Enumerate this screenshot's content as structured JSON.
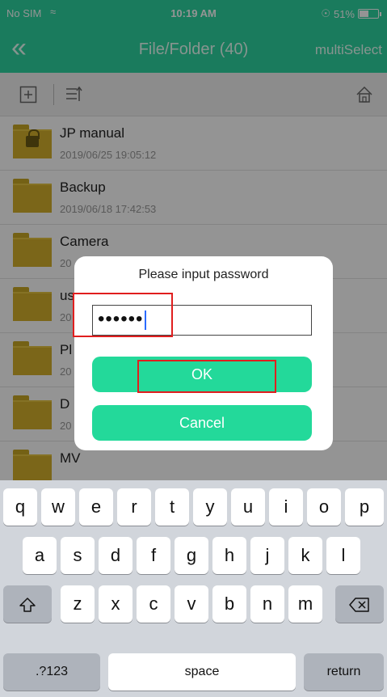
{
  "status": {
    "carrier": "No SIM",
    "time": "10:19 AM",
    "battery": "51%",
    "battery_level": 0.51
  },
  "nav": {
    "back_icon": "double-chevron-left",
    "title": "File/Folder (40)",
    "multi_select": "multiSelect"
  },
  "toolbar": {
    "icons": [
      "add-folder-icon",
      "sort-icon",
      "home-icon"
    ]
  },
  "files": [
    {
      "name": "JP manual",
      "date": "2019/06/25 19:05:12",
      "locked": true
    },
    {
      "name": "Backup",
      "date": "2019/06/18 17:42:53",
      "locked": false
    },
    {
      "name": "Camera",
      "date": "20",
      "locked": false
    },
    {
      "name": "us",
      "date": "20",
      "locked": false
    },
    {
      "name": "Pl",
      "date": "20",
      "locked": false
    },
    {
      "name": "D",
      "date": "20",
      "locked": false
    },
    {
      "name": "MV",
      "date": "",
      "locked": false
    }
  ],
  "dialog": {
    "title": "Please input password",
    "password_value": "••••••",
    "ok_label": "OK",
    "cancel_label": "Cancel"
  },
  "keyboard": {
    "row1": [
      "q",
      "w",
      "e",
      "r",
      "t",
      "y",
      "u",
      "i",
      "o",
      "p"
    ],
    "row2": [
      "a",
      "s",
      "d",
      "f",
      "g",
      "h",
      "j",
      "k",
      "l"
    ],
    "row3": [
      "z",
      "x",
      "c",
      "v",
      "b",
      "n",
      "m"
    ],
    "shift_icon": "shift-icon",
    "delete_icon": "backspace-icon",
    "numbers_label": ".?123",
    "space_label": "space",
    "return_label": "return"
  },
  "colors": {
    "accent": "#2dd4a1",
    "button": "#23d99a",
    "folder": "#d4b02c",
    "highlight": "#e01e1e"
  }
}
